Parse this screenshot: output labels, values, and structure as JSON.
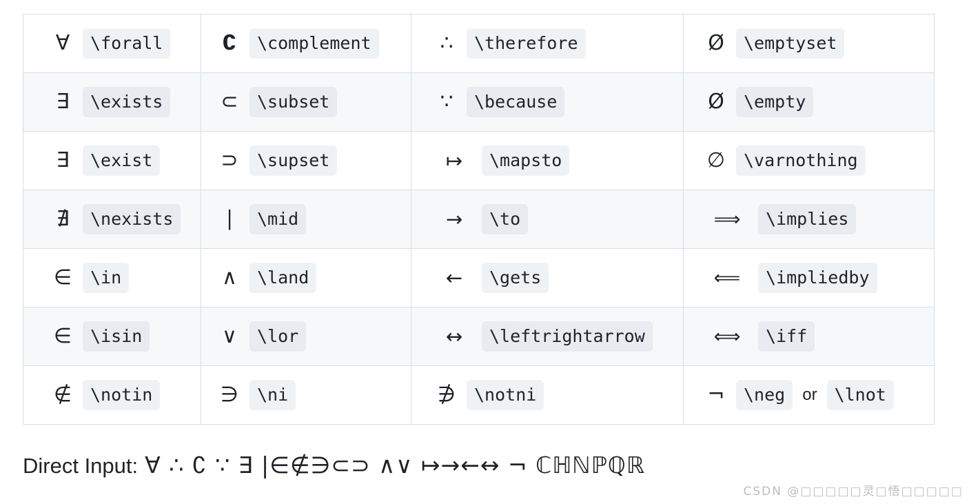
{
  "table": {
    "columns": 4,
    "rows": [
      [
        {
          "symbol": "∀",
          "codes": [
            "\\forall"
          ],
          "sym_class": ""
        },
        {
          "symbol": "∁",
          "codes": [
            "\\complement"
          ],
          "sym_class": "bold"
        },
        {
          "symbol": "∴",
          "codes": [
            "\\therefore"
          ],
          "sym_class": ""
        },
        {
          "symbol": "Ø",
          "codes": [
            "\\emptyset"
          ],
          "sym_class": ""
        }
      ],
      [
        {
          "symbol": "∃",
          "codes": [
            "\\exists"
          ],
          "sym_class": ""
        },
        {
          "symbol": "⊂",
          "codes": [
            "\\subset"
          ],
          "sym_class": ""
        },
        {
          "symbol": "∵",
          "codes": [
            "\\because"
          ],
          "sym_class": ""
        },
        {
          "symbol": "Ø",
          "codes": [
            "\\empty"
          ],
          "sym_class": ""
        }
      ],
      [
        {
          "symbol": "∃",
          "codes": [
            "\\exist"
          ],
          "sym_class": ""
        },
        {
          "symbol": "⊃",
          "codes": [
            "\\supset"
          ],
          "sym_class": ""
        },
        {
          "symbol": "↦",
          "codes": [
            "\\mapsto"
          ],
          "sym_class": "wide"
        },
        {
          "symbol": "∅",
          "codes": [
            "\\varnothing"
          ],
          "sym_class": ""
        }
      ],
      [
        {
          "symbol": "∄",
          "codes": [
            "\\nexists"
          ],
          "sym_class": ""
        },
        {
          "symbol": "∣",
          "codes": [
            "\\mid"
          ],
          "sym_class": ""
        },
        {
          "symbol": "→",
          "codes": [
            "\\to"
          ],
          "sym_class": "wide"
        },
        {
          "symbol": "⟹",
          "codes": [
            "\\implies"
          ],
          "sym_class": "xwide"
        }
      ],
      [
        {
          "symbol": "∈",
          "codes": [
            "\\in"
          ],
          "sym_class": ""
        },
        {
          "symbol": "∧",
          "codes": [
            "\\land"
          ],
          "sym_class": ""
        },
        {
          "symbol": "←",
          "codes": [
            "\\gets"
          ],
          "sym_class": "wide"
        },
        {
          "symbol": "⟸",
          "codes": [
            "\\impliedby"
          ],
          "sym_class": "xwide"
        }
      ],
      [
        {
          "symbol": "∈",
          "codes": [
            "\\isin"
          ],
          "sym_class": ""
        },
        {
          "symbol": "∨",
          "codes": [
            "\\lor"
          ],
          "sym_class": ""
        },
        {
          "symbol": "↔",
          "codes": [
            "\\leftrightarrow"
          ],
          "sym_class": "wide"
        },
        {
          "symbol": "⟺",
          "codes": [
            "\\iff"
          ],
          "sym_class": "xwide"
        }
      ],
      [
        {
          "symbol": "∉",
          "codes": [
            "\\notin"
          ],
          "sym_class": ""
        },
        {
          "symbol": "∋",
          "codes": [
            "\\ni"
          ],
          "sym_class": ""
        },
        {
          "symbol": "∌",
          "codes": [
            "\\notni"
          ],
          "sym_class": ""
        },
        {
          "symbol": "¬",
          "codes": [
            "\\neg",
            "\\lnot"
          ],
          "separator": "or",
          "sym_class": ""
        }
      ]
    ]
  },
  "direct_input": {
    "label": "Direct Input:",
    "glyphs": "∀ ∴ ∁ ∵ ∃ |∈∉∋⊂⊃ ∧∨ ↦→←↔ ¬ ℂℍℕℙℚℝ"
  },
  "watermark": {
    "text": "CSDN @□□□□□灵□悟□□□□□"
  }
}
